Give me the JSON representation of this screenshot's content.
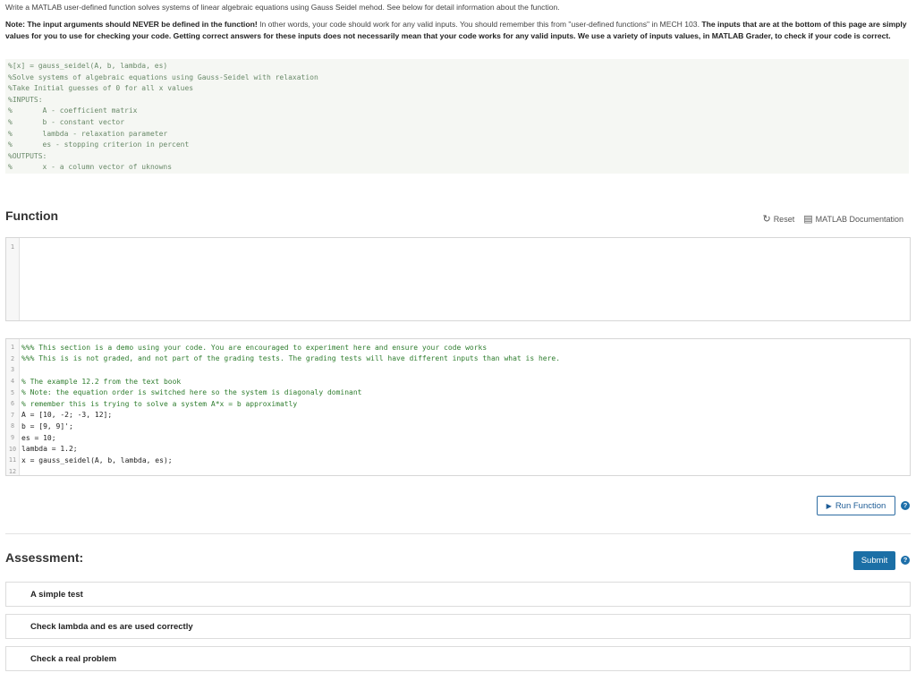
{
  "intro": {
    "line1": "Write a MATLAB user-defined function solves systems of linear algebraic equations using Gauss Seidel mehod. See below for detail information about the function.",
    "note_label": "Note: The input arguments should NEVER be defined in the function!",
    "note_mid": " In other words, your code should work for any valid inputs. You should remember this from \"user-defined functions\" in MECH 103. ",
    "note_bold": "The inputs that are at the bottom of this page are simply values for you to use for checking your code. Getting correct answers for these inputs does not necessarily mean that your code works for any valid inputs. We use a variety of inputs values, in MATLAB Grader, to check if your code is correct."
  },
  "description_code": [
    "%[x] = gauss_seidel(A, b, lambda, es)",
    "%Solve systems of algebraic equations using Gauss-Seidel with relaxation",
    "%Take Initial guesses of 0 for all x values",
    "%INPUTS:",
    "%       A - coefficient matrix",
    "%       b - constant vector",
    "%       lambda - relaxation parameter",
    "%       es - stopping criterion in percent",
    "%OUTPUTS:",
    "%       x - a column vector of uknowns"
  ],
  "function_section": {
    "title": "Function",
    "reset_label": "Reset",
    "docs_label": "MATLAB Documentation",
    "editor_line": "1"
  },
  "script": {
    "lines": [
      {
        "n": "1",
        "text": "%%% This section is a demo using your code. You are encouraged to experiment here and ensure your code works",
        "kind": "cm"
      },
      {
        "n": "2",
        "text": "%%% This is is not graded, and not part of the grading tests. The grading tests will have different inputs than what is here.",
        "kind": "cm"
      },
      {
        "n": "3",
        "text": "",
        "kind": "cd"
      },
      {
        "n": "4",
        "text": "% The example 12.2 from the text book",
        "kind": "cm"
      },
      {
        "n": "5",
        "text": "% Note: the equation order is switched here so the system is diagonaly dominant",
        "kind": "cm"
      },
      {
        "n": "6",
        "text": "% remember this is trying to solve a system A*x = b approximatly",
        "kind": "cm"
      },
      {
        "n": "7",
        "text": "A = [10, -2; -3, 12];",
        "kind": "cd"
      },
      {
        "n": "8",
        "text": "b = [9, 9]';",
        "kind": "cd"
      },
      {
        "n": "9",
        "text": "es = 10;",
        "kind": "cd"
      },
      {
        "n": "10",
        "text": "lambda = 1.2;",
        "kind": "cd"
      },
      {
        "n": "11",
        "text": "x = gauss_seidel(A, b, lambda, es);",
        "kind": "cd"
      },
      {
        "n": "12",
        "text": "",
        "kind": "cd"
      }
    ]
  },
  "run_label": "Run Function",
  "assessment": {
    "title": "Assessment:",
    "submit_label": "Submit",
    "tests": [
      "A simple test",
      "Check lambda and es are used correctly",
      "Check a real problem"
    ]
  },
  "help_glyph": "?",
  "colors": {
    "accent": "#1b6fa6",
    "comment": "#2f7d2f"
  }
}
